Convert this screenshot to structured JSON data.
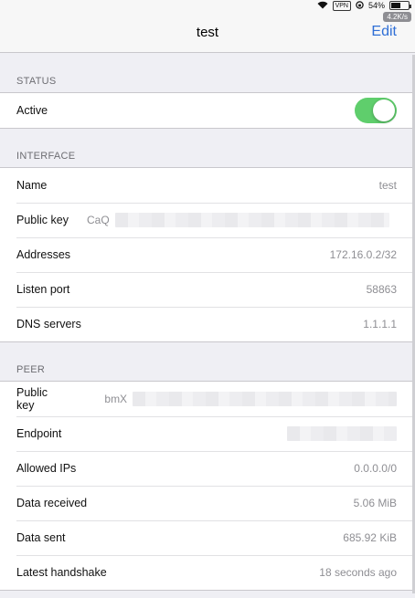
{
  "statusbar": {
    "vpn": "VPN",
    "battery_text": "54%",
    "battery_level": 0.54,
    "speed": "4.2K/s"
  },
  "nav": {
    "title": "test",
    "edit_label": "Edit"
  },
  "status": {
    "header": "STATUS",
    "active_label": "Active",
    "active_on": true
  },
  "interface": {
    "header": "INTERFACE",
    "name_label": "Name",
    "name_value": "test",
    "public_key_label": "Public key",
    "public_key_prefix": "CaQ",
    "addresses_label": "Addresses",
    "addresses_value": "172.16.0.2/32",
    "listen_port_label": "Listen port",
    "listen_port_value": "58863",
    "dns_label": "DNS servers",
    "dns_value": "1.1.1.1"
  },
  "peer": {
    "header": "PEER",
    "public_key_label": "Public key",
    "public_key_prefix": "bmX",
    "endpoint_label": "Endpoint",
    "allowed_ips_label": "Allowed IPs",
    "allowed_ips_value": "0.0.0.0/0",
    "data_received_label": "Data received",
    "data_received_value": "5.06 MiB",
    "data_sent_label": "Data sent",
    "data_sent_value": "685.92 KiB",
    "handshake_label": "Latest handshake",
    "handshake_value": "18 seconds ago"
  },
  "colors": {
    "accent": "#2f6fd6",
    "toggle_on": "#5fce6c"
  }
}
